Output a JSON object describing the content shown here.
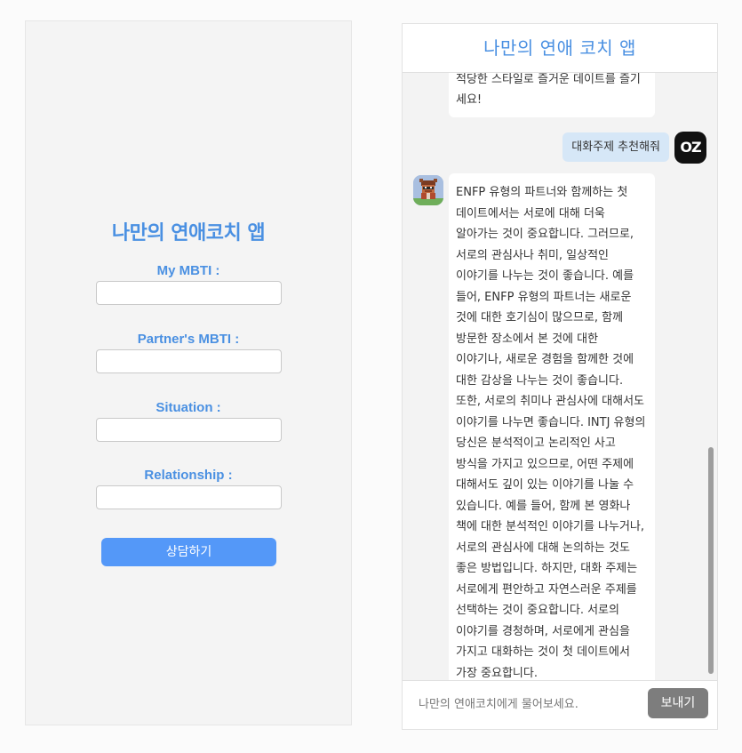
{
  "form": {
    "title": "나만의 연애코치 앱",
    "fields": [
      {
        "label": "My MBTI :",
        "value": "",
        "placeholder": ""
      },
      {
        "label": "Partner's MBTI :",
        "value": "",
        "placeholder": ""
      },
      {
        "label": "Situation :",
        "value": "",
        "placeholder": ""
      },
      {
        "label": "Relationship :",
        "value": "",
        "placeholder": ""
      }
    ],
    "submit_label": "상담하기",
    "colors": {
      "accent": "#4a90e2",
      "button": "#5498f8"
    }
  },
  "chat": {
    "title": "나만의 연애 코치 앱",
    "messages": [
      {
        "role": "bot",
        "text": "적당한 스타일로 즐거운 데이트를 즐기세요!"
      },
      {
        "role": "user",
        "text": "대화주제 추천해줘"
      },
      {
        "role": "bot",
        "text": "ENFP 유형의 파트너와 함께하는 첫 데이트에서는 서로에 대해 더욱 알아가는 것이 중요합니다. 그러므로, 서로의 관심사나 취미, 일상적인 이야기를 나누는 것이 좋습니다. 예를 들어, ENFP 유형의 파트너는 새로운 것에 대한 호기심이 많으므로, 함께 방문한 장소에서 본 것에 대한 이야기나, 새로운 경험을 함께한 것에 대한 감상을 나누는 것이 좋습니다. 또한, 서로의 취미나 관심사에 대해서도 이야기를 나누면 좋습니다. INTJ 유형의 당신은 분석적이고 논리적인 사고 방식을 가지고 있으므로, 어떤 주제에 대해서도 깊이 있는 이야기를 나눌 수 있습니다. 예를 들어, 함께 본 영화나 책에 대한 분석적인 이야기를 나누거나, 서로의 관심사에 대해 논의하는 것도 좋은 방법입니다. 하지만, 대화 주제는 서로에게 편안하고 자연스러운 주제를 선택하는 것이 중요합니다. 서로의 이야기를 경청하며, 서로에게 관심을 가지고 대화하는 것이 첫 데이트에서 가장 중요합니다."
      }
    ],
    "user_avatar_text": "OZ",
    "bot_avatar_icon": "pixel-character-icon",
    "input_placeholder": "나만의 연애코치에게 물어보세요.",
    "send_label": "보내기",
    "colors": {
      "user_bubble": "#d6e7f7",
      "send_button": "#7d7d7d"
    },
    "scroll_position": 0.62
  }
}
